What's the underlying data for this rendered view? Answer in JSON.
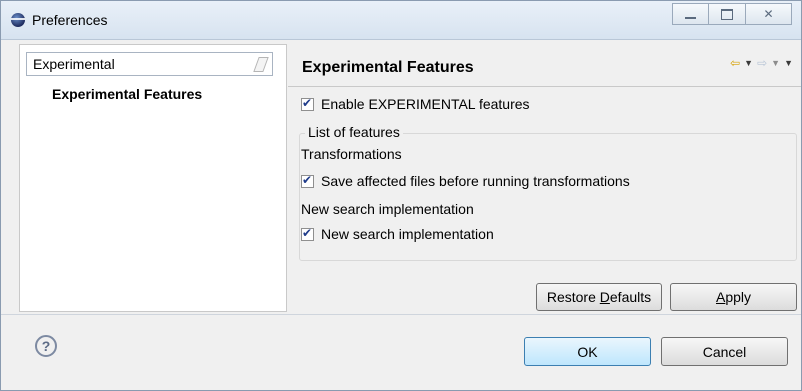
{
  "window": {
    "title": "Preferences",
    "controls": {
      "minimize": "",
      "maximize": "",
      "close": "✕"
    }
  },
  "left": {
    "filter": {
      "value": "Experimental",
      "placeholder": ""
    },
    "tree": [
      {
        "label": "Experimental Features",
        "selected": true
      }
    ]
  },
  "page": {
    "title": "Experimental Features",
    "nav": {
      "back": "⇦",
      "forward": "⇨",
      "dropdown": "▼"
    },
    "enable": {
      "label": "Enable EXPERIMENTAL features",
      "checked": true
    },
    "group": {
      "legend": "List of features",
      "transformations_heading": "Transformations",
      "save_files": {
        "label": "Save affected files before running transformations",
        "checked": true
      },
      "search_heading": "New search implementation",
      "search": {
        "label": "New search implementation",
        "checked": true
      }
    },
    "buttons": {
      "restore": {
        "pre": "Restore ",
        "mnemonic": "D",
        "post": "efaults"
      },
      "apply": {
        "pre": "",
        "mnemonic": "A",
        "post": "pply"
      }
    }
  },
  "footer": {
    "help": "?",
    "ok": "OK",
    "cancel": "Cancel"
  },
  "colors": {
    "accent": "#3c7fb1",
    "nav_back": "#d6a000",
    "check": "#1f3b8a"
  }
}
